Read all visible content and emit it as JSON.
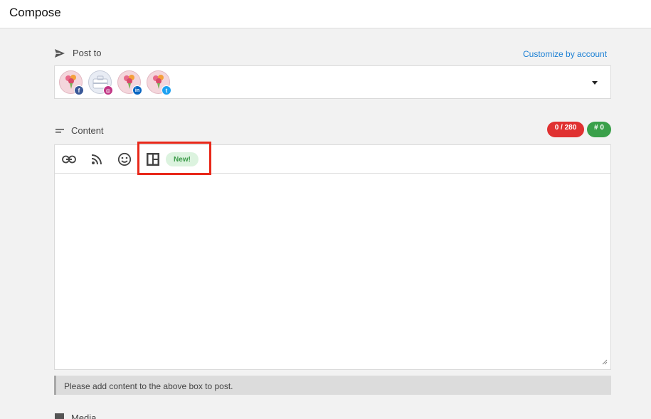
{
  "header": {
    "title": "Compose"
  },
  "post_to": {
    "label": "Post to",
    "customize_link": "Customize by account",
    "accounts": [
      {
        "network": "facebook",
        "badge_text": "f",
        "badge_color": "#3b5998"
      },
      {
        "network": "instagram",
        "badge_text": "◎",
        "badge_color": "#c13584"
      },
      {
        "network": "linkedin",
        "badge_text": "in",
        "badge_color": "#0a66c2"
      },
      {
        "network": "twitter",
        "badge_text": "t",
        "badge_color": "#1da1f2"
      }
    ]
  },
  "content": {
    "label": "Content",
    "char_count": "0 / 280",
    "hashtag_count": "# 0",
    "char_count_color": "#e03131",
    "hashtag_count_color": "#3aa04a",
    "toolbar": {
      "icons": [
        "link-icon",
        "rss-icon",
        "emoji-icon",
        "layout-icon"
      ],
      "new_badge": "New!"
    },
    "textarea_value": ""
  },
  "notice": "Please add content to the above box to post.",
  "media": {
    "label": "Media"
  },
  "colors": {
    "accent_link": "#1a7fd4",
    "highlight_box": "#e8281a"
  }
}
